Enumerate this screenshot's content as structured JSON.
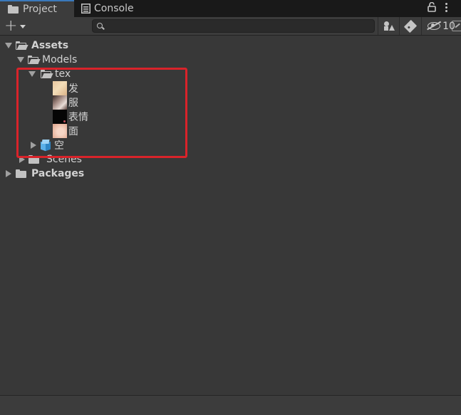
{
  "tabs": [
    {
      "label": "Project",
      "icon": "folder-icon",
      "active": true
    },
    {
      "label": "Console",
      "icon": "console-icon",
      "active": false
    }
  ],
  "toolbar": {
    "add_label": "+",
    "search": {
      "value": "",
      "placeholder": ""
    },
    "hidden_packages_count": "10"
  },
  "tree": {
    "assets": "Assets",
    "models": "Models",
    "tex": "tex",
    "textures": [
      "发",
      "服",
      "表情",
      "面"
    ],
    "prefab": "空",
    "scenes": "Scenes",
    "packages": "Packages"
  },
  "colors": {
    "background": "#383838",
    "tabbar": "#191919",
    "active_tab_accent": "#3a79bb",
    "highlight": "#d9232a",
    "prefab_icon": "#5ab0e8"
  }
}
